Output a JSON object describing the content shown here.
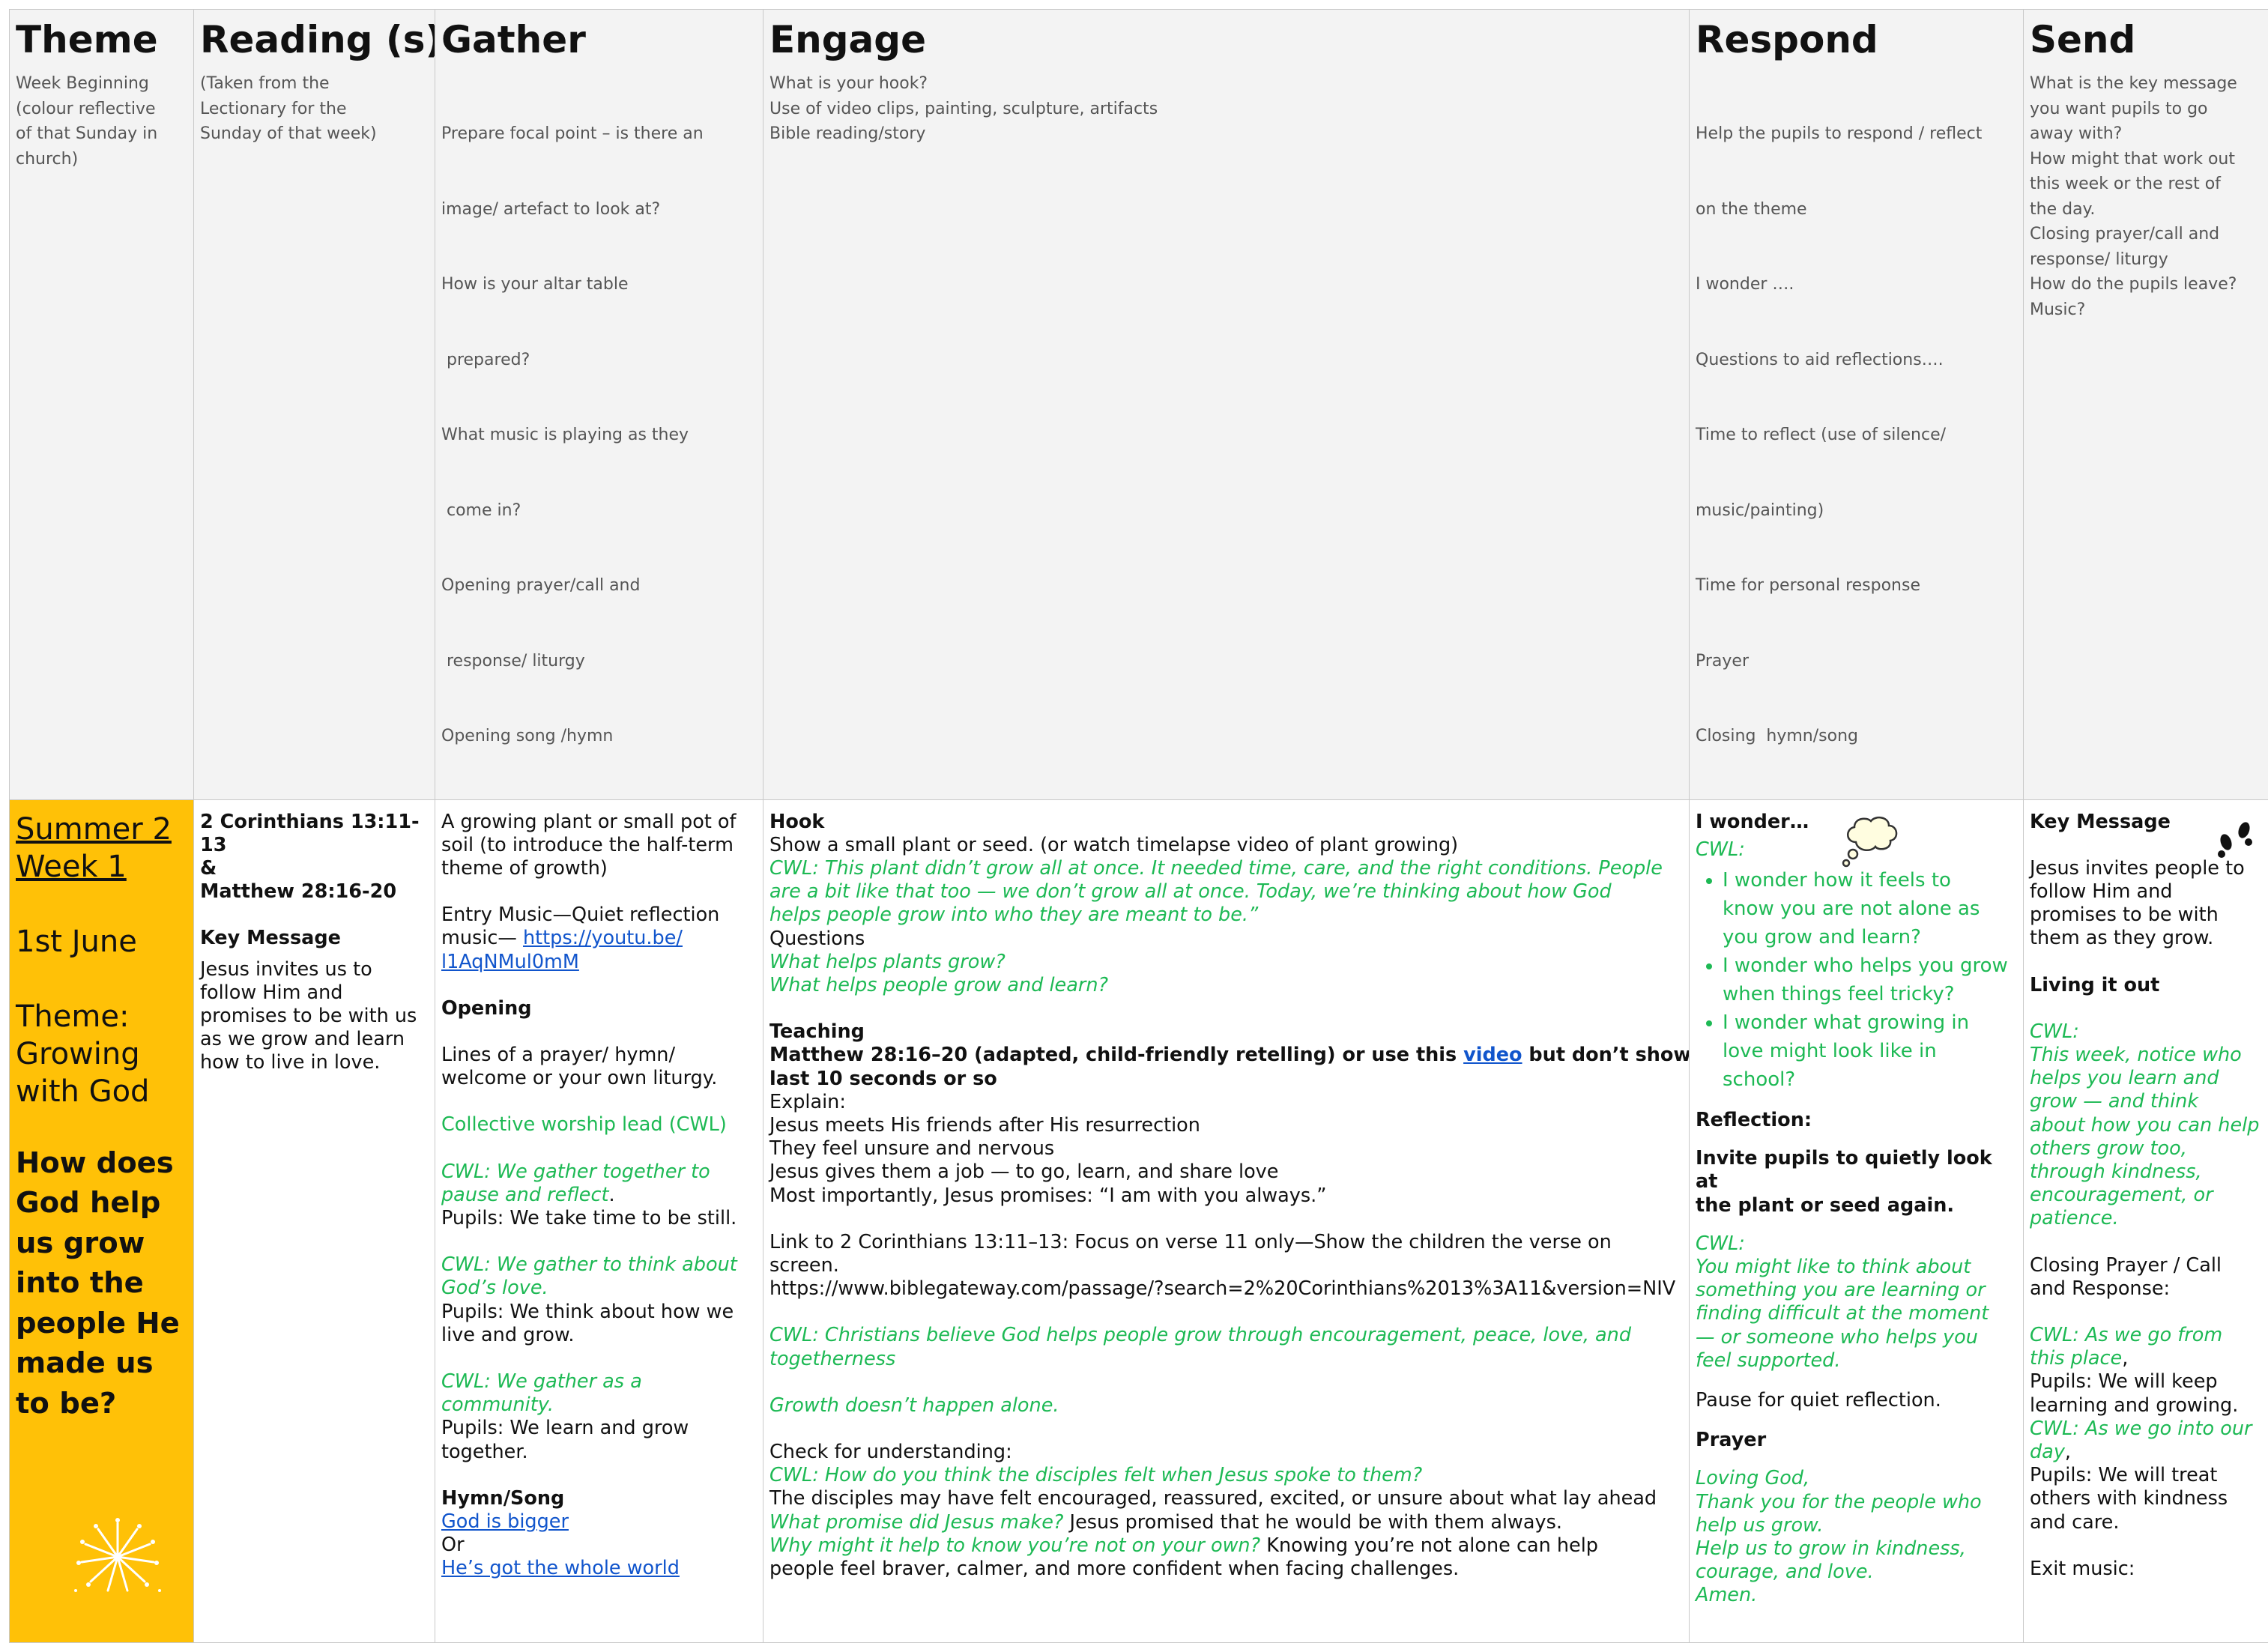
{
  "header": {
    "theme": {
      "title": "Theme",
      "lines": [
        "Week Beginning",
        "(colour reflective",
        "of that Sunday in",
        "church)"
      ]
    },
    "reading": {
      "title": "Reading (s)",
      "lines": [
        "(Taken from the",
        "Lectionary for the",
        "Sunday of that week)"
      ]
    },
    "gather": {
      "title": "Gather",
      "lines": [
        "Prepare focal point – is there an",
        "image/ artefact to look at?",
        "How is your altar table",
        " prepared?",
        "What music is playing as they",
        " come in?",
        "Opening prayer/call and",
        " response/ liturgy",
        "Opening song /hymn"
      ]
    },
    "engage": {
      "title": "Engage",
      "lines": [
        "What is your hook?",
        "Use of video clips, painting, sculpture, artifacts",
        "Bible reading/story"
      ]
    },
    "respond": {
      "title": "Respond",
      "lines": [
        "Help the pupils to respond / reflect",
        "on the theme",
        "I wonder ….",
        "Questions to aid reflections….",
        "Time to reflect (use of silence/",
        "music/painting)",
        "Time for personal response",
        "Prayer",
        "Closing  hymn/song"
      ]
    },
    "send": {
      "title": "Send",
      "lines": [
        "What is the key message",
        "you want pupils to go",
        "away with?",
        "How might that work out",
        "this week or the rest of",
        "the day.",
        "Closing prayer/call and",
        "response/ liturgy",
        "How do the pupils leave?",
        "Music?"
      ]
    }
  },
  "theme": {
    "week_line1": "Summer 2",
    "week_line2": "Week 1",
    "date": "1st June",
    "theme_label": "Theme:",
    "theme_line1": "Growing",
    "theme_line2": "with God",
    "question_lines": [
      "How does",
      "God help",
      "us grow",
      "into the",
      "people He",
      "made us",
      "to be?"
    ],
    "icon": "fireworks-icon",
    "bg_color": "#ffc107"
  },
  "reading": {
    "ref1": "2 Corinthians 13:11-13",
    "amp": "&",
    "ref2": "Matthew 28:16-20",
    "key_heading": "Key Message",
    "key_lines": [
      "Jesus invites us to",
      "follow Him and",
      "promises to be with us",
      "as we grow and learn",
      "how to live in love."
    ]
  },
  "gather": {
    "intro_lines": [
      "A growing plant or small pot of",
      "soil (to introduce the half-term",
      "theme of growth)"
    ],
    "entry_music": "Entry Music—Quiet reflection",
    "music_prefix": "music— ",
    "link1_line1": "https://youtu.be/",
    "link1_line2": "l1AqNMul0mM",
    "opening_heading": "Opening",
    "opening_lines": [
      "Lines of a prayer/ hymn/",
      "welcome or your own liturgy."
    ],
    "cwl_lead": "Collective worship lead (CWL)",
    "cwl1_line1": "CWL: We gather together to",
    "cwl1_line2": "pause and reflect",
    "cwl1_dot": ".",
    "pupils1": "Pupils: We take time to be still.",
    "cwl2_line1": "CWL: We gather to think about",
    "cwl2_line2": "God’s love.",
    "pupils2_line1": "Pupils: We think about how we",
    "pupils2_line2": "live and grow.",
    "cwl3_line1": "CWL: We gather as a",
    "cwl3_line2": "community.",
    "pupils3_line1": "Pupils: We learn and grow",
    "pupils3_line2": "together.",
    "hymn_heading": "Hymn/Song",
    "song1": "God is bigger",
    "or": "Or",
    "song2": "He’s got the whole world"
  },
  "engage": {
    "hook_heading": "Hook",
    "hook_text": "Show a small plant or seed. (or watch timelapse video of plant growing)",
    "cwl_hook_lines": [
      "CWL: This plant didn’t grow all at once. It needed time, care, and the right conditions. People",
      "are a bit like that too — we don’t grow all at once. Today, we’re thinking about how God",
      "helps people grow into who they are meant to be.”"
    ],
    "questions_label": "Questions",
    "q1": "What helps plants grow?",
    "q2": "What helps people grow and learn?",
    "teaching_heading": "Teaching",
    "teaching_line1_a": "Matthew 28:16–20 (adapted, child-friendly retelling) or use this ",
    "teaching_link": "video",
    "teaching_line1_b": " but don’t show the",
    "teaching_line2": "last 10 seconds or so",
    "explain_lines": [
      "Explain:",
      "Jesus meets His friends after His resurrection",
      "They feel unsure and nervous",
      "Jesus gives them a job — to go, learn, and share love",
      "Most importantly, Jesus promises: “I am with you always.”"
    ],
    "link_lines": [
      "Link to 2 Corinthians 13:11–13: Focus on verse 11 only—Show the children the verse on",
      "screen.",
      "https://www.biblegateway.com/passage/?search=2%20Corinthians%2013%3A11&version=NIV"
    ],
    "cwl_christians_lines": [
      "CWL: Christians believe God helps people grow through encouragement, peace, love, and",
      "togetherness"
    ],
    "growth": "Growth doesn’t happen alone.",
    "check": "Check for understanding:",
    "cwl_q1": "CWL: How do you think the disciples felt when Jesus spoke to them?",
    "ans1": "The disciples may have felt encouraged, reassured, excited, or unsure about what lay ahead",
    "q_promise": "What promise did Jesus make?",
    "ans2": " Jesus promised that he would be with them always.",
    "q_why": "Why might it help to know you’re not on your own?",
    "ans3": " Knowing you’re not alone can help",
    "ans3_line2": "people feel braver, calmer, and more confident when facing challenges."
  },
  "respond": {
    "wonder_heading": "I wonder…",
    "cwl_label": "CWL:",
    "wonder_items": [
      [
        "I wonder how it feels to",
        "know you are not alone as",
        "you grow and learn?"
      ],
      [
        "I wonder who helps you grow",
        "when things feel tricky?"
      ],
      [
        "I wonder what growing in",
        "love might look like in",
        "school?"
      ]
    ],
    "reflection_heading": "Reflection:",
    "invite_lines": [
      "Invite pupils to quietly look at",
      "the plant or seed again."
    ],
    "cwl2_lines": [
      "CWL:",
      "You might like to think about",
      "something you are learning or",
      "finding difficult at the moment",
      "— or someone who helps you",
      "feel supported."
    ],
    "pause": "Pause for quiet reflection.",
    "prayer_heading": "Prayer",
    "prayer_lines": [
      "Loving God,",
      "Thank you for the people who",
      "help us grow.",
      "Help us to grow in kindness,",
      "courage, and love.",
      "Amen."
    ],
    "icon": "thought-bubble-icon"
  },
  "send": {
    "key_heading": "Key Message",
    "key_lines": [
      "Jesus invites people to",
      "follow Him and",
      "promises to be with",
      "them as they grow."
    ],
    "living_heading": "Living it out",
    "cwl_lines": [
      "CWL:",
      "This week, notice who",
      "helps you learn and",
      "grow — and think",
      "about how you can help",
      "others grow too,",
      "through kindness,",
      "encouragement, or",
      "patience."
    ],
    "closing_lines": [
      "Closing Prayer / Call",
      "and Response:"
    ],
    "cwl_go1_line1": "CWL: As we go from",
    "cwl_go1_line2": "this place",
    "comma": ",",
    "pupils1_lines": [
      "Pupils: We will keep",
      "learning and growing."
    ],
    "cwl_go2_line1": "CWL: As we go into our",
    "cwl_go2_line2": "day",
    "pupils2_lines": [
      "Pupils: We will treat",
      "others with kindness",
      "and care."
    ],
    "exit": "Exit music:",
    "icon": "footprints-icon"
  }
}
